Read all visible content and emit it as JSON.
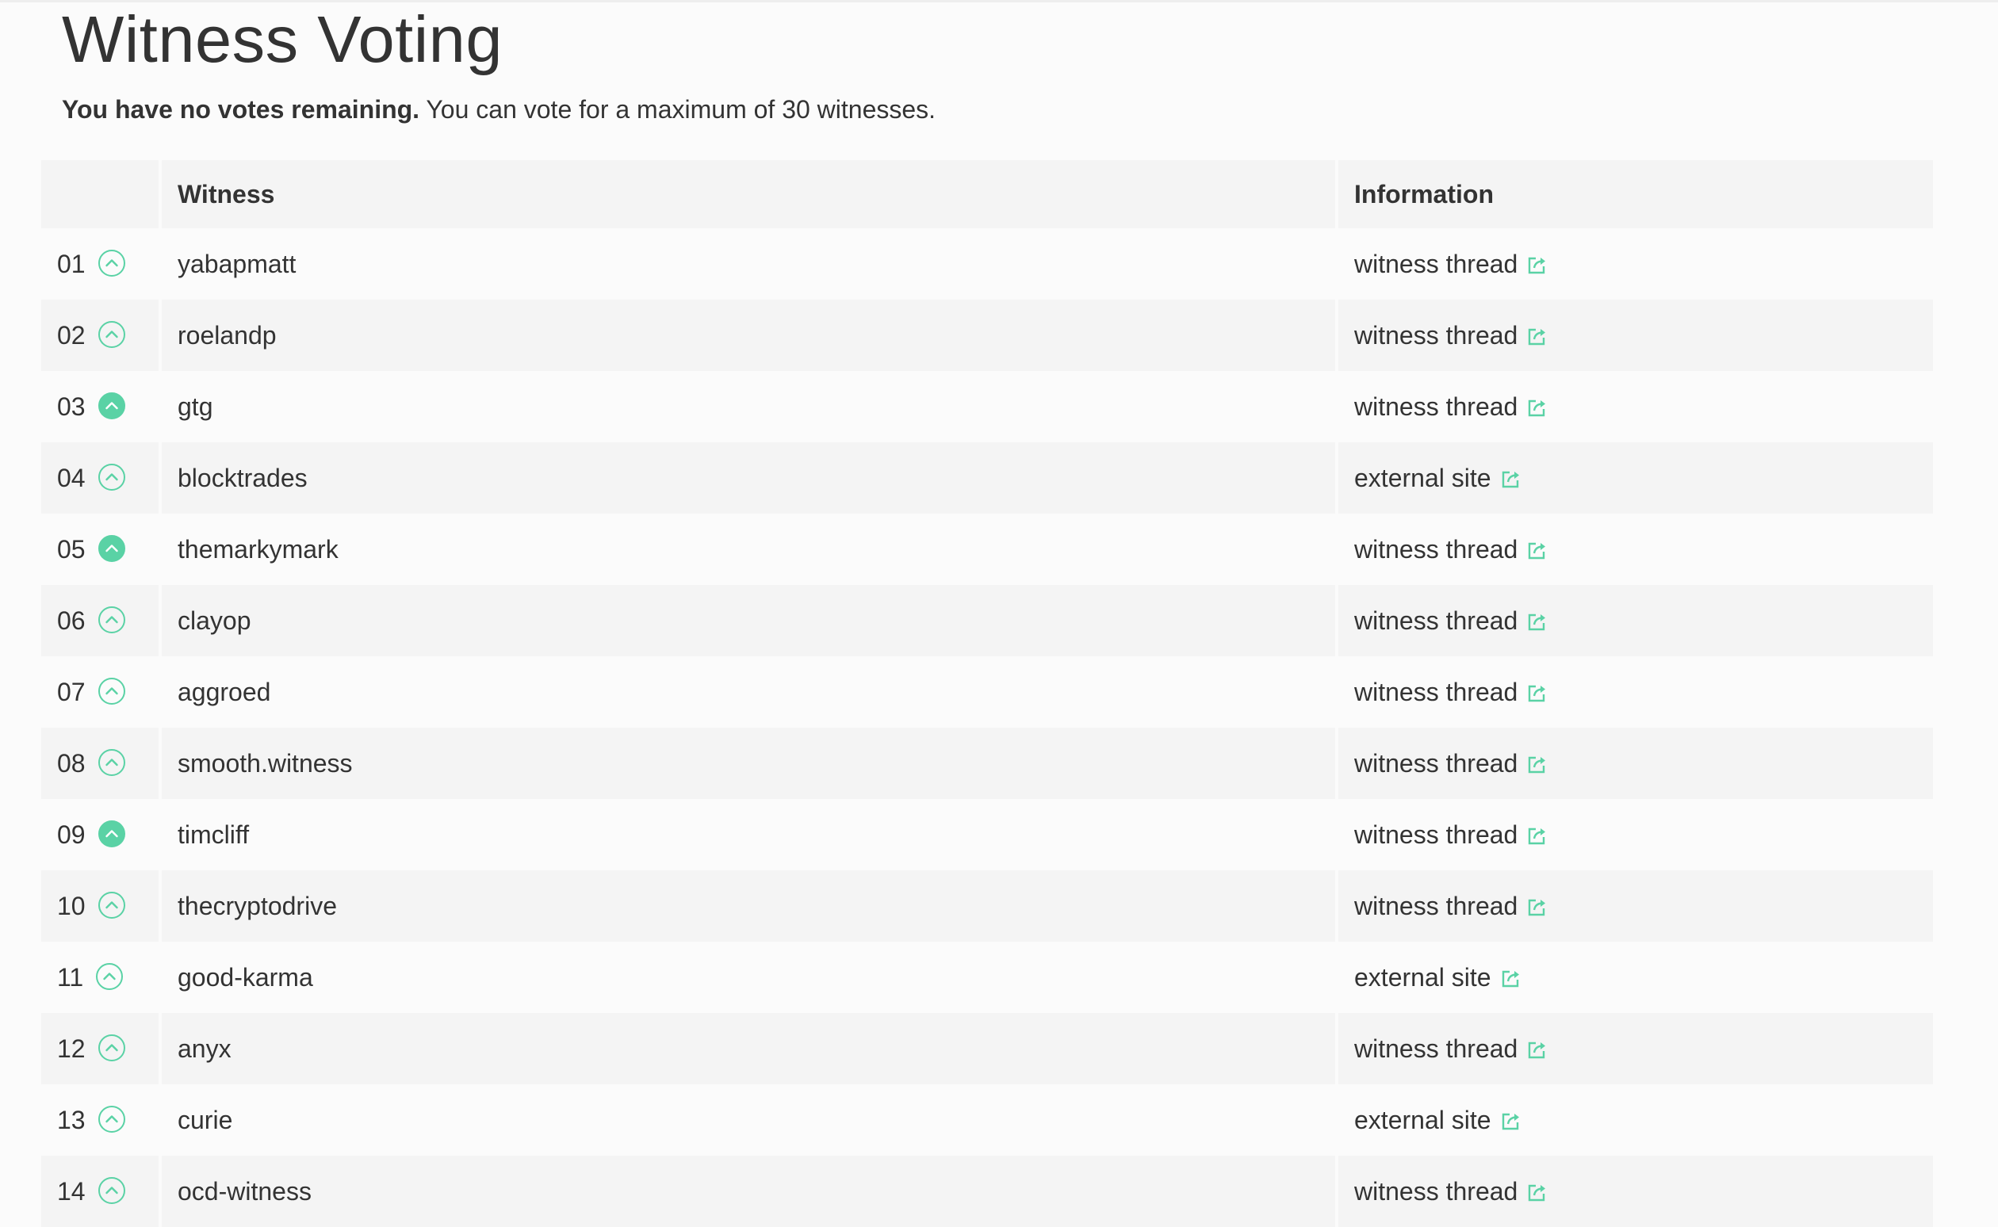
{
  "page": {
    "title": "Witness Voting",
    "subtitle_bold": "You have no votes remaining.",
    "subtitle_rest": " You can vote for a maximum of 30 witnesses."
  },
  "table": {
    "headers": {
      "rank": "",
      "witness": "Witness",
      "information": "Information"
    },
    "rows": [
      {
        "rank": "01",
        "witness": "yabapmatt",
        "info": "witness thread",
        "voted": false
      },
      {
        "rank": "02",
        "witness": "roelandp",
        "info": "witness thread",
        "voted": false
      },
      {
        "rank": "03",
        "witness": "gtg",
        "info": "witness thread",
        "voted": true
      },
      {
        "rank": "04",
        "witness": "blocktrades",
        "info": "external site",
        "voted": false
      },
      {
        "rank": "05",
        "witness": "themarkymark",
        "info": "witness thread",
        "voted": true
      },
      {
        "rank": "06",
        "witness": "clayop",
        "info": "witness thread",
        "voted": false
      },
      {
        "rank": "07",
        "witness": "aggroed",
        "info": "witness thread",
        "voted": false
      },
      {
        "rank": "08",
        "witness": "smooth.witness",
        "info": "witness thread",
        "voted": false
      },
      {
        "rank": "09",
        "witness": "timcliff",
        "info": "witness thread",
        "voted": true
      },
      {
        "rank": "10",
        "witness": "thecryptodrive",
        "info": "witness thread",
        "voted": false
      },
      {
        "rank": "11",
        "witness": "good-karma",
        "info": "external site",
        "voted": false
      },
      {
        "rank": "12",
        "witness": "anyx",
        "info": "witness thread",
        "voted": false
      },
      {
        "rank": "13",
        "witness": "curie",
        "info": "external site",
        "voted": false
      },
      {
        "rank": "14",
        "witness": "ocd-witness",
        "info": "witness thread",
        "voted": false
      }
    ]
  },
  "colors": {
    "accent": "#5ad2a5",
    "row_alt": "#f4f4f4",
    "text": "#333333"
  },
  "icons": {
    "vote": "chevron-up-circle-icon",
    "link": "external-link-icon"
  }
}
